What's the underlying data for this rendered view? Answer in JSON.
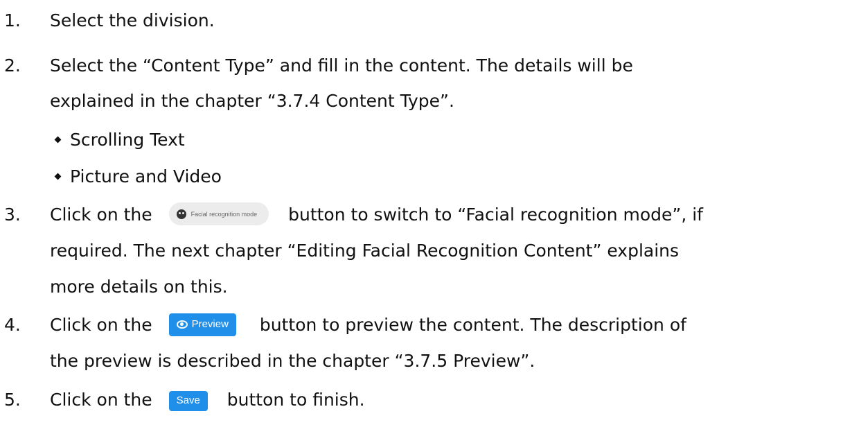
{
  "steps": [
    {
      "number": "1.",
      "text": "Select the division."
    },
    {
      "number": "2.",
      "line1": "Select the “Content Type” and fill in the content. The details will be",
      "line2": "explained in the chapter “3.7.4 Content Type”.",
      "bullets": [
        "Scrolling Text",
        "Picture and Video"
      ]
    },
    {
      "number": "3.",
      "before": "Click on the",
      "after": "button to switch to “Facial recognition mode”, if",
      "line2": "required. The next chapter “Editing Facial Recognition Content” explains",
      "line3": "more details on this.",
      "button_label": "Facial recognition mode"
    },
    {
      "number": "4.",
      "before": "Click on the",
      "after": "button to preview the content. The description of",
      "line2": "the preview is described in the chapter “3.7.5 Preview”.",
      "button_label": "Preview"
    },
    {
      "number": "5.",
      "before": "Click on the",
      "after": "button to finish.",
      "button_label": "Save"
    }
  ],
  "colors": {
    "primary_button": "#1f8fea",
    "secondary_button": "#ececec"
  }
}
